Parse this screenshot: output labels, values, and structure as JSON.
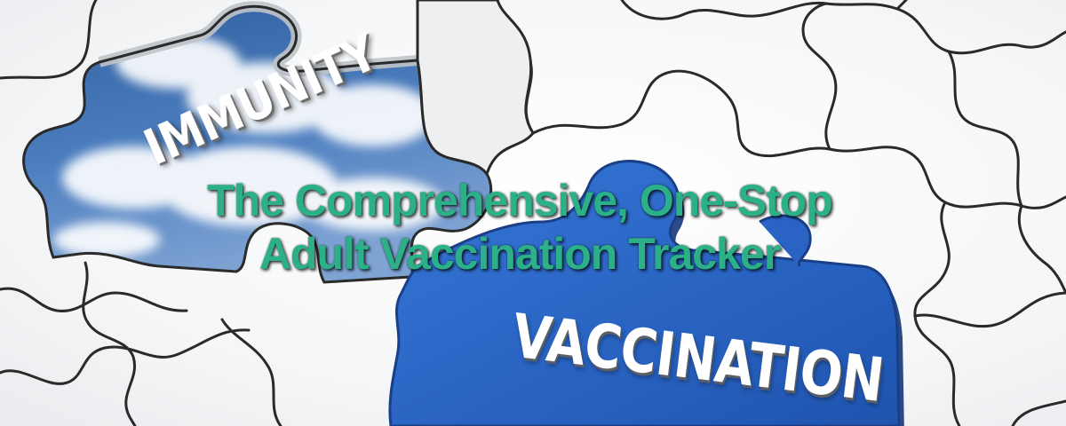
{
  "image": {
    "subject": "jigsaw puzzle with missing pieces",
    "colors": {
      "board": "#f3f4f5",
      "outline": "#2b2b2b",
      "sky": "#3f6fb5",
      "piece_blue": "#2b66c8",
      "headline": "#2bb087"
    }
  },
  "puzzle": {
    "hole_word": "IMMUNITY",
    "piece_word": "VACCINATION"
  },
  "headline": {
    "line1": "The Comprehensive, One-Stop",
    "line2": "Adult Vaccination Tracker"
  }
}
